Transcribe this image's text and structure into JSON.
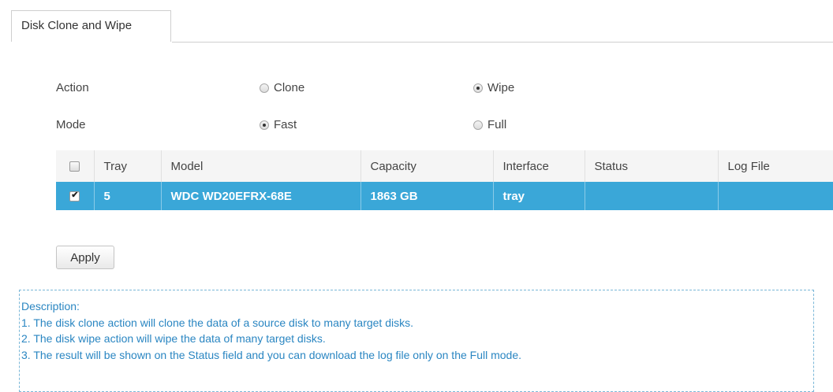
{
  "tab": {
    "label": "Disk Clone and Wipe"
  },
  "action": {
    "label": "Action",
    "options": [
      {
        "label": "Clone",
        "checked": false
      },
      {
        "label": "Wipe",
        "checked": true
      }
    ]
  },
  "mode": {
    "label": "Mode",
    "options": [
      {
        "label": "Fast",
        "checked": true
      },
      {
        "label": "Full",
        "checked": false
      }
    ]
  },
  "table": {
    "columns": [
      "Tray",
      "Model",
      "Capacity",
      "Interface",
      "Status",
      "Log File"
    ],
    "select_all_checked": false,
    "rows": [
      {
        "selected": true,
        "tray": "5",
        "model": "WDC WD20EFRX-68E",
        "capacity": "1863 GB",
        "interface": "tray",
        "status": "",
        "log_file": ""
      }
    ]
  },
  "apply_label": "Apply",
  "description": {
    "title": "Description:",
    "lines": [
      "1. The disk clone action will clone the data of a source disk to many target disks.",
      "2. The disk wipe action will wipe the data of many target disks.",
      "3. The result will be shown on the Status field and you can download the log file only on the Full mode."
    ]
  },
  "colors": {
    "selected_row": "#3aa7d8",
    "description_text": "#2a86c2",
    "description_border": "#7ab7d8"
  }
}
